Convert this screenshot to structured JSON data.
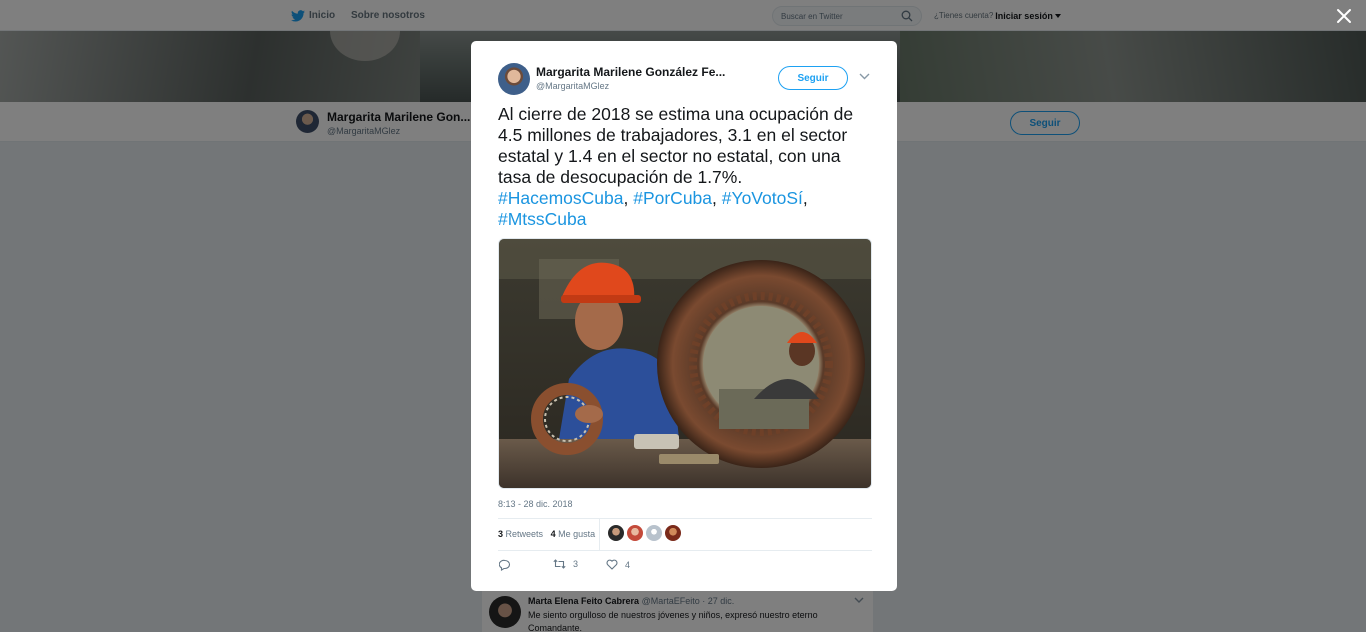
{
  "topnav": {
    "home_label": "Inicio",
    "about_label": "Sobre nosotros",
    "search_placeholder": "Buscar en Twitter",
    "account_question": "¿Tienes cuenta?",
    "login_label": "Iniciar sesión"
  },
  "profile": {
    "name": "Margarita Marilene Gon...",
    "handle": "@MargaritaMGlez",
    "follow_label": "Seguir"
  },
  "tweet": {
    "author_name": "Margarita Marilene González Fe...",
    "author_handle": "@MargaritaMGlez",
    "follow_label": "Seguir",
    "text": "Al cierre de 2018 se estima una ocupación de 4.5 millones de trabajadores, 3.1 en el sector estatal y 1.4 en el sector no estatal, con una tasa de desocupación de 1.7%.",
    "hashtags": [
      "#HacemosCuba",
      "#PorCuba",
      "#YoVotoSí",
      "#MtssCuba"
    ],
    "timestamp": "8:13 - 28 dic. 2018",
    "retweets_count": "3",
    "retweets_label": "Retweets",
    "likes_count": "4",
    "likes_label": "Me gusta",
    "reply_icon": "reply-icon",
    "retweet_action_count": "3",
    "like_action_count": "4"
  },
  "reply": {
    "name": "Marta Elena Feito Cabrera",
    "handle": "@MartaEFeito",
    "date": "· 27 dic.",
    "text": "Me siento orgulloso de nuestros jóvenes y niños, expresó nuestro eterno Comandante."
  },
  "colors": {
    "accent": "#1da1f2",
    "hashtag": "#1b95e0",
    "overlay": "rgba(0,0,0,0.5)"
  }
}
